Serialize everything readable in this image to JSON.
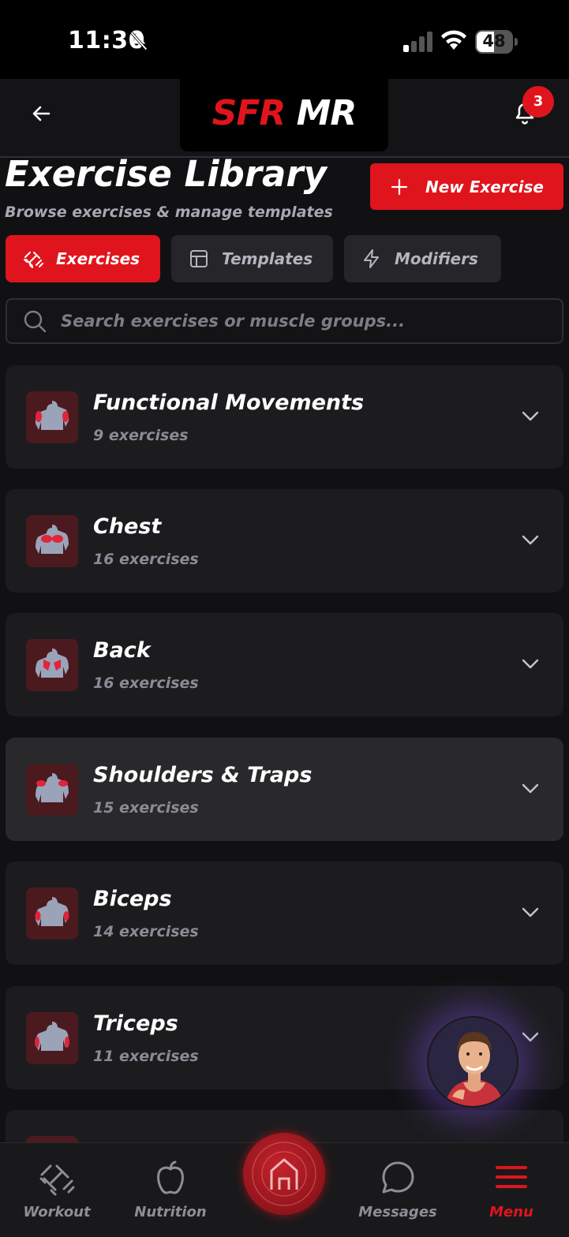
{
  "status_bar": {
    "time": "11:30",
    "battery": "48"
  },
  "header": {
    "logo_part1": "SFR",
    "logo_part2": "MR",
    "notification_count": "3"
  },
  "page": {
    "title": "Exercise Library",
    "subtitle": "Browse exercises & manage templates",
    "new_button": "New Exercise"
  },
  "tabs": [
    {
      "label": "Exercises",
      "active": true
    },
    {
      "label": "Templates",
      "active": false
    },
    {
      "label": "Modifiers",
      "active": false
    }
  ],
  "search": {
    "placeholder": "Search exercises or muscle groups..."
  },
  "categories": [
    {
      "name": "Functional Movements",
      "count": "9 exercises"
    },
    {
      "name": "Chest",
      "count": "16 exercises"
    },
    {
      "name": "Back",
      "count": "16 exercises"
    },
    {
      "name": "Shoulders & Traps",
      "count": "15 exercises"
    },
    {
      "name": "Biceps",
      "count": "14 exercises"
    },
    {
      "name": "Triceps",
      "count": "11 exercises"
    }
  ],
  "bottom_nav": [
    {
      "label": "Workout",
      "icon": "dumbbell-icon"
    },
    {
      "label": "Nutrition",
      "icon": "apple-icon"
    },
    {
      "label": "",
      "icon": "home-icon"
    },
    {
      "label": "Messages",
      "icon": "chat-bubble-icon"
    },
    {
      "label": "Menu",
      "icon": "hamburger-menu-icon",
      "active": true
    }
  ],
  "colors": {
    "accent": "#e0141c",
    "background": "#111113",
    "card": "#1c1c1f"
  }
}
